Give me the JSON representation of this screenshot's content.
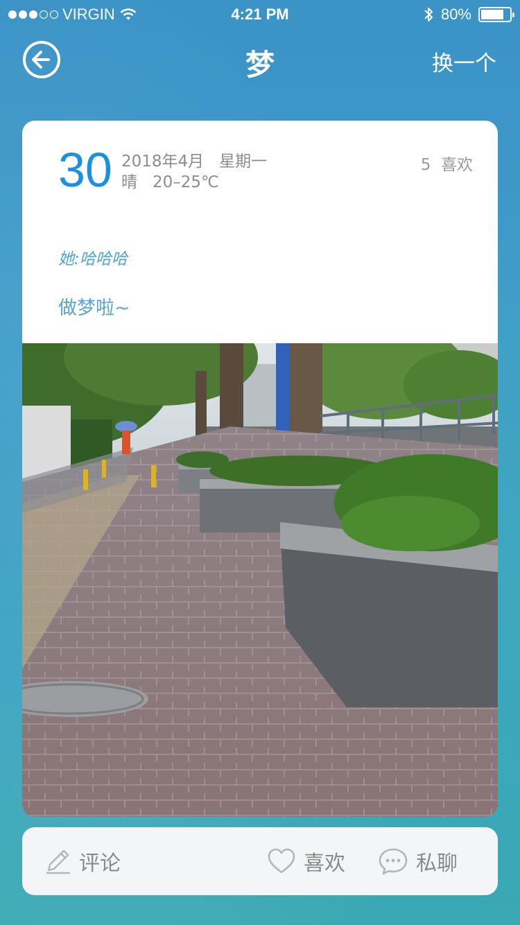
{
  "status_bar": {
    "carrier": "VIRGIN",
    "time": "4:21 PM",
    "battery_percent": "80%",
    "battery_level": 0.8,
    "signal_bars": 3
  },
  "nav": {
    "title": "梦",
    "switch_label": "换一个"
  },
  "post": {
    "day": "30",
    "year_month": "2018年4月",
    "weekday": "星期一",
    "weather": "晴",
    "temperature": "20–25℃",
    "likes_count": "5",
    "likes_label": "喜欢",
    "author_line": "她:哈哈哈",
    "content": "做梦啦~"
  },
  "actions": {
    "comment_label": "评论",
    "like_label": "喜欢",
    "chat_label": "私聊"
  },
  "colors": {
    "accent": "#1b8fe0",
    "content_text": "#56a6d6",
    "muted_text": "#8d8d8d",
    "background": "#3f9cc9"
  }
}
